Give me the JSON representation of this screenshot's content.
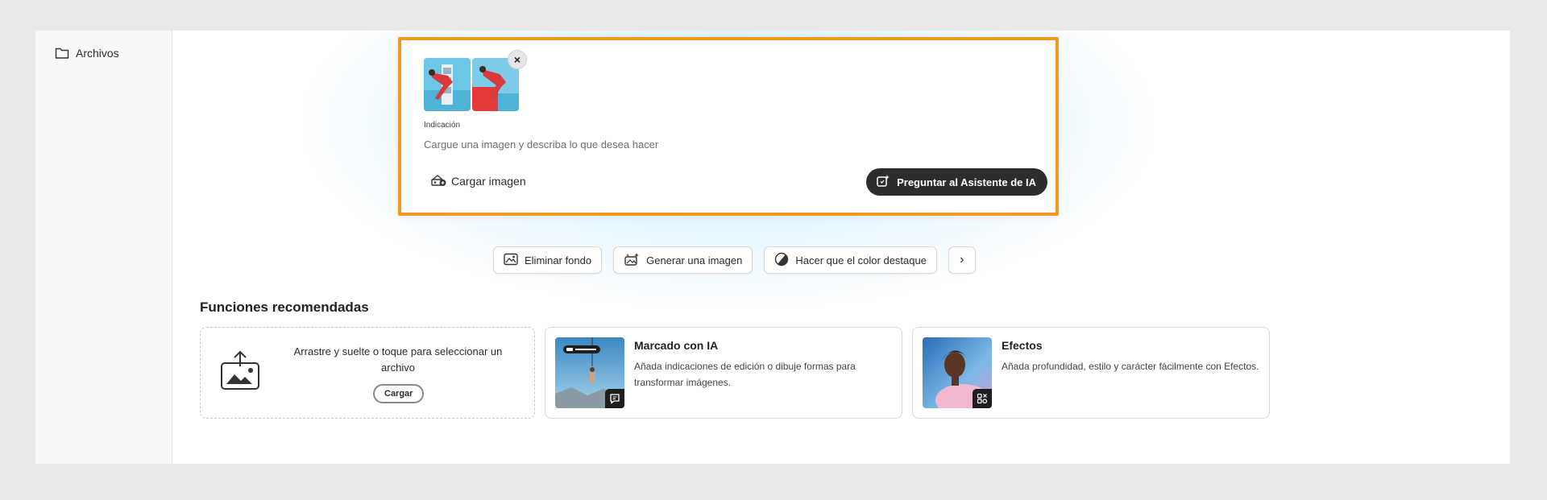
{
  "sidebar": {
    "items": [
      {
        "label": "Archivos",
        "icon": "folder-icon"
      }
    ]
  },
  "prompt": {
    "label": "Indicación",
    "placeholder": "Cargue una imagen y describa lo que desea hacer",
    "upload_label": "Cargar imagen",
    "ask_label": "Preguntar al Asistente de IA",
    "close_glyph": "×",
    "highlight_color": "#f29a1f"
  },
  "chips": [
    {
      "label": "Eliminar fondo",
      "icon": "remove-background-icon"
    },
    {
      "label": "Generar una imagen",
      "icon": "generate-image-icon"
    },
    {
      "label": "Hacer que el color destaque",
      "icon": "color-pop-icon"
    }
  ],
  "chips_next_glyph": "›",
  "recommended": {
    "title": "Funciones recomendadas",
    "dropzone": {
      "text": "Arrastre y suelte o toque para seleccionar un archivo",
      "button_label": "Cargar"
    },
    "cards": [
      {
        "title": "Marcado con IA",
        "description": "Añada indicaciones de edición o dibuje formas para transformar imágenes."
      },
      {
        "title": "Efectos",
        "description": "Añada profundidad, estilo y carácter fácilmente con Efectos."
      }
    ]
  }
}
